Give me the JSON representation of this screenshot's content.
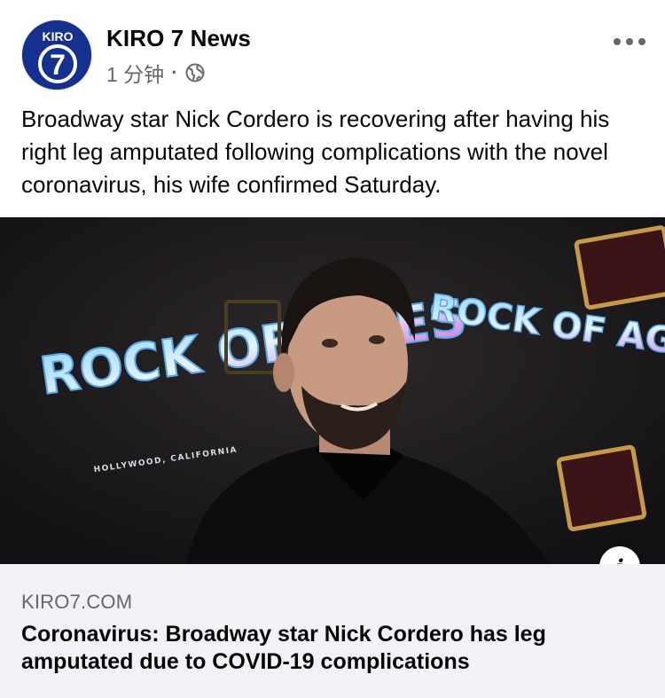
{
  "post": {
    "page_name": "KIRO 7 News",
    "timestamp": "1 分钟",
    "separator": "·",
    "avatar_text": "KIRO",
    "avatar_number": "7",
    "text": "Broadway star Nick Cordero is recovering after having his right leg amputated following complications with the novel coronavirus, his wife confirmed Saturday.",
    "icons": {
      "audience": "globe-icon",
      "more": "more-options-icon",
      "info": "info-icon"
    }
  },
  "photo": {
    "sign_left": "ROCK OF AGES",
    "sign_left_sub": "HOLLYWOOD, CALIFORNIA",
    "sign_right": "ROCK OF AGES"
  },
  "link": {
    "domain": "KIRO7.COM",
    "title": "Coronavirus: Broadway star Nick Cordero has leg amputated due to COVID-19 complications"
  },
  "colors": {
    "brand_blue": "#16308f",
    "link_bg": "#f0f2f5",
    "secondary_text": "#65676b"
  }
}
